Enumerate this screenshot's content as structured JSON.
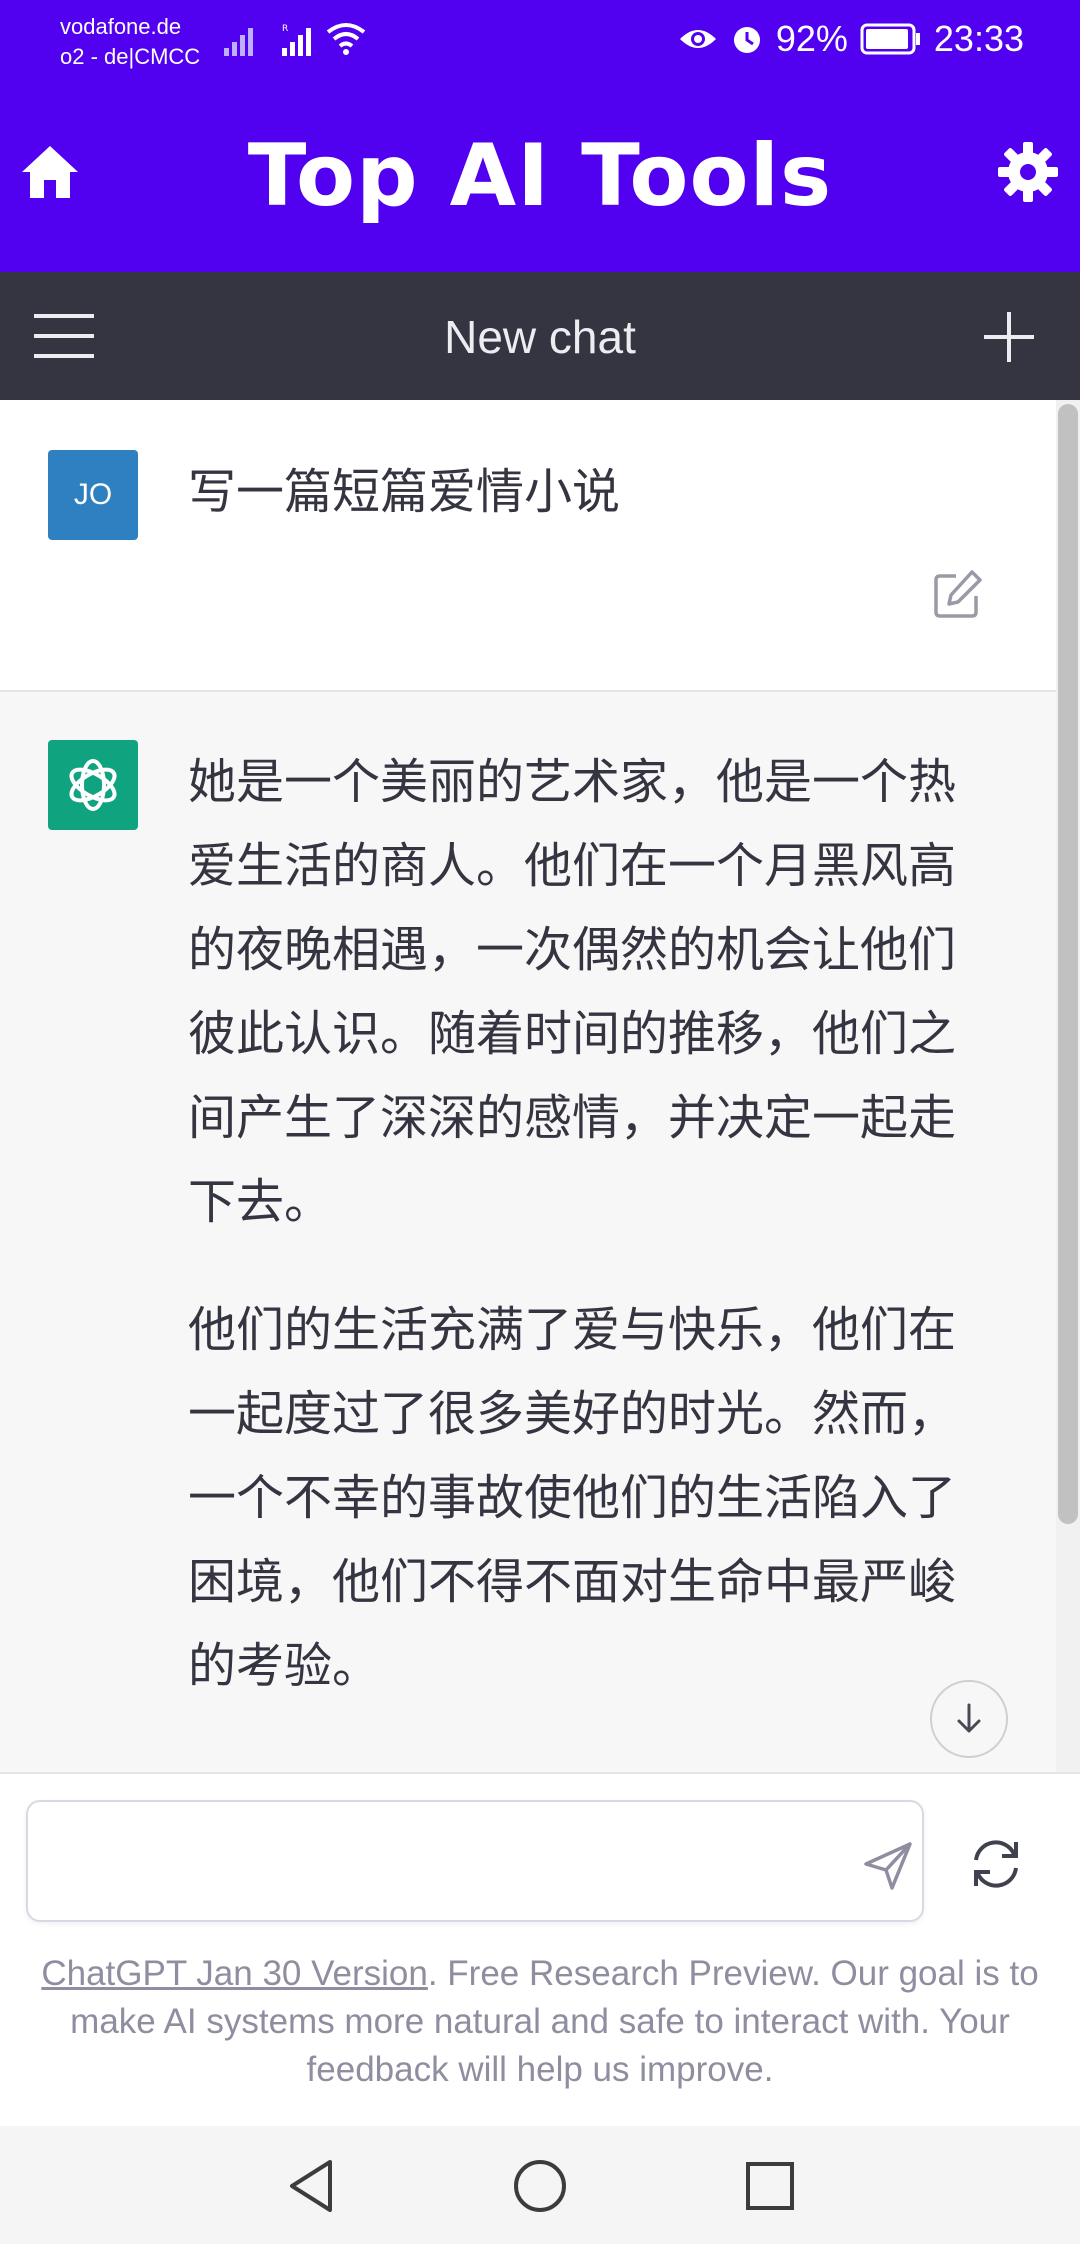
{
  "status_bar": {
    "carrier_line1": "vodafone.de",
    "carrier_line2": "o2 - de|CMCC",
    "battery": "92%",
    "time": "23:33"
  },
  "app_header": {
    "title": "Top AI Tools",
    "home_icon": "home-icon",
    "settings_icon": "gear-icon",
    "background": "#5200f0"
  },
  "chat_header": {
    "title": "New chat",
    "menu_icon": "hamburger-menu-icon",
    "new_icon": "plus-icon",
    "background": "#343541"
  },
  "conversation": {
    "user": {
      "avatar_initials": "JO",
      "avatar_color": "#2f80c0",
      "text": "写一篇短篇爱情小说"
    },
    "assistant": {
      "avatar_color": "#10a37f",
      "paragraphs": [
        "她是一个美丽的艺术家，他是一个热爱生活的商人。他们在一个月黑风高的夜晚相遇，一次偶然的机会让他们彼此认识。随着时间的推移，他们之间产生了深深的感情，并决定一起走下去。",
        "他们的生活充满了爱与快乐，他们在一起度过了很多美好的时光。然而，一个不幸的事故使他们的生活陷入了困境，他们不得不面对生命中最严峻的考验。"
      ]
    }
  },
  "composer": {
    "input_value": "",
    "input_placeholder": "",
    "send_icon": "send-icon",
    "regenerate_icon": "refresh-icon"
  },
  "footer": {
    "link_text": "ChatGPT Jan 30 Version",
    "note": ". Free Research Preview. Our goal is to make AI systems more natural and safe to interact with. Your feedback will help us improve."
  },
  "nav_bar": {
    "back_icon": "back-triangle-icon",
    "home_icon": "home-circle-icon",
    "recent_icon": "recent-square-icon"
  }
}
